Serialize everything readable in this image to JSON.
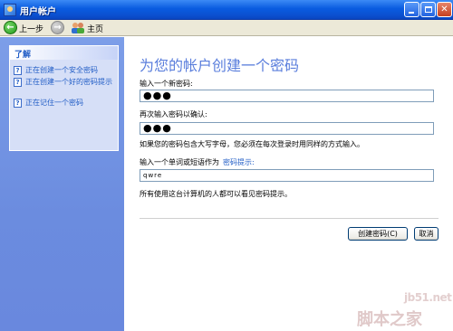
{
  "window": {
    "title": "用户帐户"
  },
  "toolbar": {
    "back_label": "上一步",
    "home_label": "主页"
  },
  "sidebar": {
    "header": "了解",
    "items": [
      {
        "label": "正在创建一个安全密码"
      },
      {
        "label": "正在创建一个好的密码提示"
      },
      {
        "label": "正在记住一个密码"
      }
    ]
  },
  "main": {
    "title": "为您的帐户创建一个密码",
    "new_password_label": "输入一个新密码:",
    "new_password_value": "●●●",
    "confirm_label": "再次输入密码以确认:",
    "confirm_value": "●●●",
    "case_note": "如果您的密码包含大写字母，您必须在每次登录时用同样的方式输入。",
    "hint_label": "输入一个单词或短语作为",
    "hint_link": "密码提示:",
    "hint_value": "qwre",
    "visibility_note": "所有使用这台计算机的人都可以看见密码提示。",
    "create_button": "创建密码(C)",
    "cancel_button": "取消"
  },
  "watermark": {
    "site": "jb51.net",
    "brand": "脚本之家"
  },
  "colors": {
    "titlebar": "#0b5ce0",
    "sidebar": "#7d9ee8",
    "link": "#215dc6",
    "heading": "#5a7edc",
    "back_button": "#1f9a1a"
  }
}
